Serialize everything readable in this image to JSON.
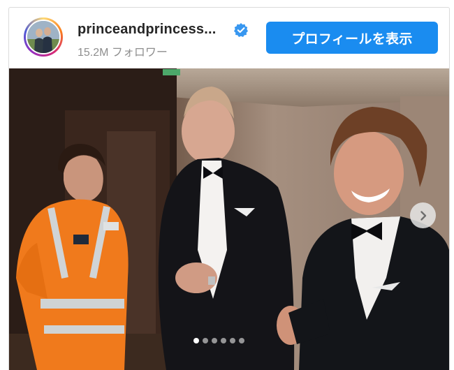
{
  "post": {
    "username": "princeandprincess...",
    "followers": "15.2M フォロワー",
    "profile_button": "プロフィールを表示",
    "verified": true
  },
  "carousel": {
    "total_slides": 6,
    "active_slide": 1,
    "next_icon": "chevron-right-icon"
  },
  "colors": {
    "button_bg": "#1a8cf0",
    "verified_badge": "#3897f0",
    "username": "#262626",
    "followers": "#8e8e8e"
  }
}
